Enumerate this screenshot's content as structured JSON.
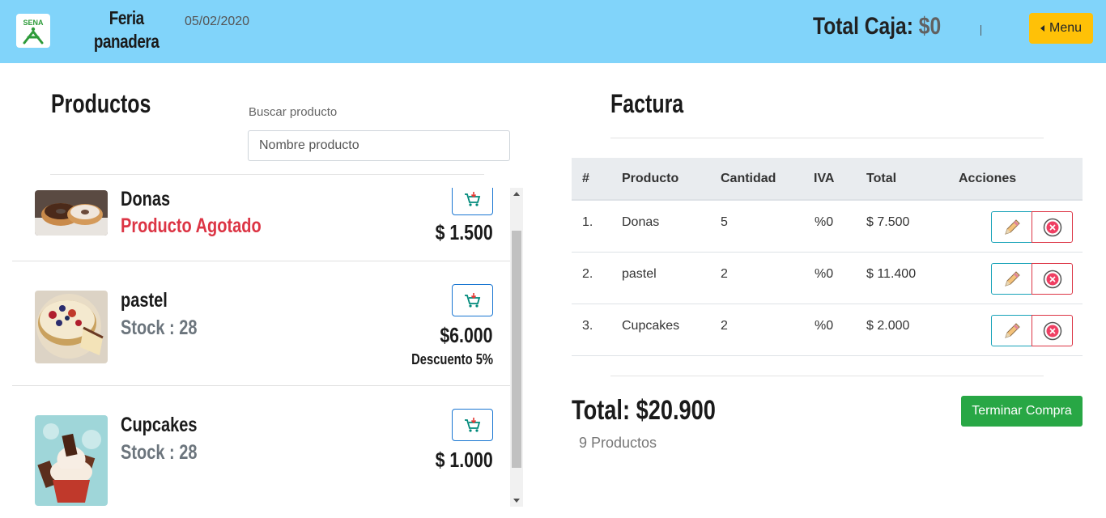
{
  "header": {
    "brand_line1": "Feria",
    "brand_line2": "panadera",
    "date": "05/02/2020",
    "total_caja_label": "Total Caja:",
    "total_caja_value": "$0",
    "divider": "|",
    "menu_label": "Menu",
    "logo_text": "SENA",
    "colors": {
      "bar": "#81d4fa",
      "menu": "#ffc107"
    }
  },
  "products_panel": {
    "title": "Productos",
    "search_label": "Buscar producto",
    "search_placeholder": "Nombre producto",
    "items": [
      {
        "name": "Donas",
        "status": "Producto Agotado",
        "price": "$ 1.500",
        "discount": ""
      },
      {
        "name": "pastel",
        "status": "Stock : 28",
        "price": "$6.000",
        "discount": "Descuento 5%"
      },
      {
        "name": "Cupcakes",
        "status": "Stock : 28",
        "price": "$ 1.000",
        "discount": ""
      }
    ],
    "colors": {
      "agotado": "#dc3545",
      "stock": "#6c757d"
    }
  },
  "invoice": {
    "title": "Factura",
    "columns": [
      "#",
      "Producto",
      "Cantidad",
      "IVA",
      "Total",
      "Acciones"
    ],
    "rows": [
      {
        "num": "1.",
        "product": "Donas",
        "qty": "5",
        "iva": "%0",
        "total": "$ 7.500"
      },
      {
        "num": "2.",
        "product": "pastel",
        "qty": "2",
        "iva": "%0",
        "total": "$ 11.400"
      },
      {
        "num": "3.",
        "product": "Cupcakes",
        "qty": "2",
        "iva": "%0",
        "total": "$ 2.000"
      }
    ],
    "total_label": "Total: $20.900",
    "count_label": "9 Productos",
    "finish_label": "Terminar Compra"
  }
}
